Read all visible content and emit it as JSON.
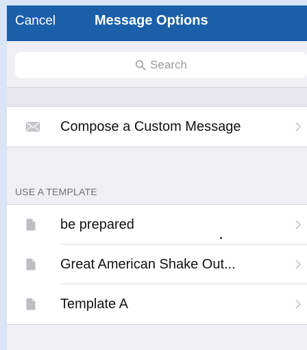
{
  "navbar": {
    "cancel_label": "Cancel",
    "title": "Message Options",
    "background": "#1b5fa8"
  },
  "search": {
    "placeholder": "Search"
  },
  "custom": {
    "label": "Compose a Custom Message",
    "icon": "envelope-icon"
  },
  "templates": {
    "header": "USE A TEMPLATE",
    "items": [
      {
        "label": "be prepared",
        "icon": "document-icon"
      },
      {
        "label": "Great American Shake Out...",
        "icon": "document-icon"
      },
      {
        "label": "Template A",
        "icon": "document-icon"
      }
    ]
  }
}
